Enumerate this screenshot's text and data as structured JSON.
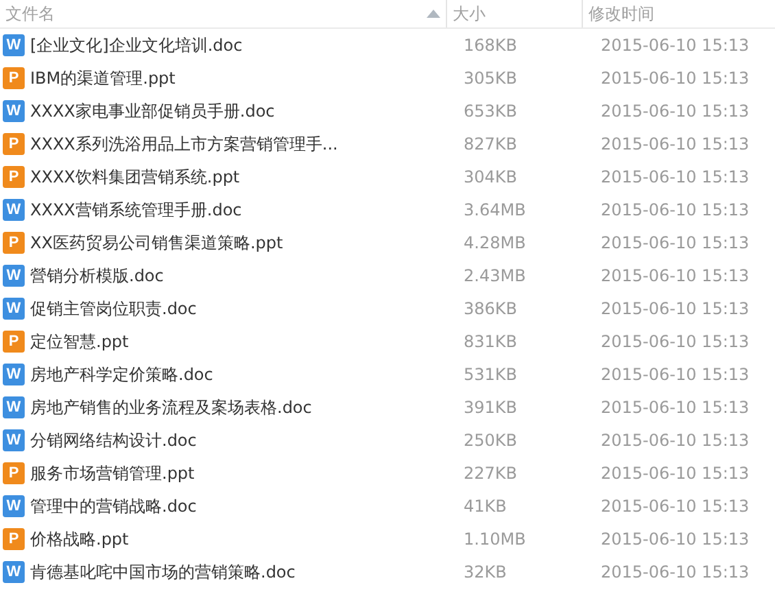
{
  "columns": [
    {
      "label": "文件名",
      "sorted": true
    },
    {
      "label": "大小",
      "sorted": false
    },
    {
      "label": "修改时间",
      "sorted": false
    }
  ],
  "files": [
    {
      "kind": "doc",
      "badge": "W",
      "name": "[企业文化]企业文化培训.doc",
      "size": "168KB",
      "modified": "2015-06-10 15:13"
    },
    {
      "kind": "ppt",
      "badge": "P",
      "name": "IBM的渠道管理.ppt",
      "size": "305KB",
      "modified": "2015-06-10 15:13"
    },
    {
      "kind": "doc",
      "badge": "W",
      "name": "XXXX家电事业部促销员手册.doc",
      "size": "653KB",
      "modified": "2015-06-10 15:13"
    },
    {
      "kind": "ppt",
      "badge": "P",
      "name": "XXXX系列洗浴用品上市方案营销管理手...",
      "size": "827KB",
      "modified": "2015-06-10 15:13"
    },
    {
      "kind": "ppt",
      "badge": "P",
      "name": "XXXX饮料集团营销系统.ppt",
      "size": "304KB",
      "modified": "2015-06-10 15:13"
    },
    {
      "kind": "doc",
      "badge": "W",
      "name": "XXXX营销系统管理手册.doc",
      "size": "3.64MB",
      "modified": "2015-06-10 15:13"
    },
    {
      "kind": "ppt",
      "badge": "P",
      "name": "XX医药贸易公司销售渠道策略.ppt",
      "size": "4.28MB",
      "modified": "2015-06-10 15:13"
    },
    {
      "kind": "doc",
      "badge": "W",
      "name": "營销分析模版.doc",
      "size": "2.43MB",
      "modified": "2015-06-10 15:13"
    },
    {
      "kind": "doc",
      "badge": "W",
      "name": "促销主管岗位职责.doc",
      "size": "386KB",
      "modified": "2015-06-10 15:13"
    },
    {
      "kind": "ppt",
      "badge": "P",
      "name": "定位智慧.ppt",
      "size": "831KB",
      "modified": "2015-06-10 15:13"
    },
    {
      "kind": "doc",
      "badge": "W",
      "name": "房地产科学定价策略.doc",
      "size": "531KB",
      "modified": "2015-06-10 15:13"
    },
    {
      "kind": "doc",
      "badge": "W",
      "name": "房地产销售的业务流程及案场表格.doc",
      "size": "391KB",
      "modified": "2015-06-10 15:13"
    },
    {
      "kind": "doc",
      "badge": "W",
      "name": "分销网络结构设计.doc",
      "size": "250KB",
      "modified": "2015-06-10 15:13"
    },
    {
      "kind": "ppt",
      "badge": "P",
      "name": "服务市场营销管理.ppt",
      "size": "227KB",
      "modified": "2015-06-10 15:13"
    },
    {
      "kind": "doc",
      "badge": "W",
      "name": "管理中的营销战略.doc",
      "size": "41KB",
      "modified": "2015-06-10 15:13"
    },
    {
      "kind": "ppt",
      "badge": "P",
      "name": "价格战略.ppt",
      "size": "1.10MB",
      "modified": "2015-06-10 15:13"
    },
    {
      "kind": "doc",
      "badge": "W",
      "name": "肯德基叱咤中国市场的营销策略.doc",
      "size": "32KB",
      "modified": "2015-06-10 15:13"
    }
  ]
}
